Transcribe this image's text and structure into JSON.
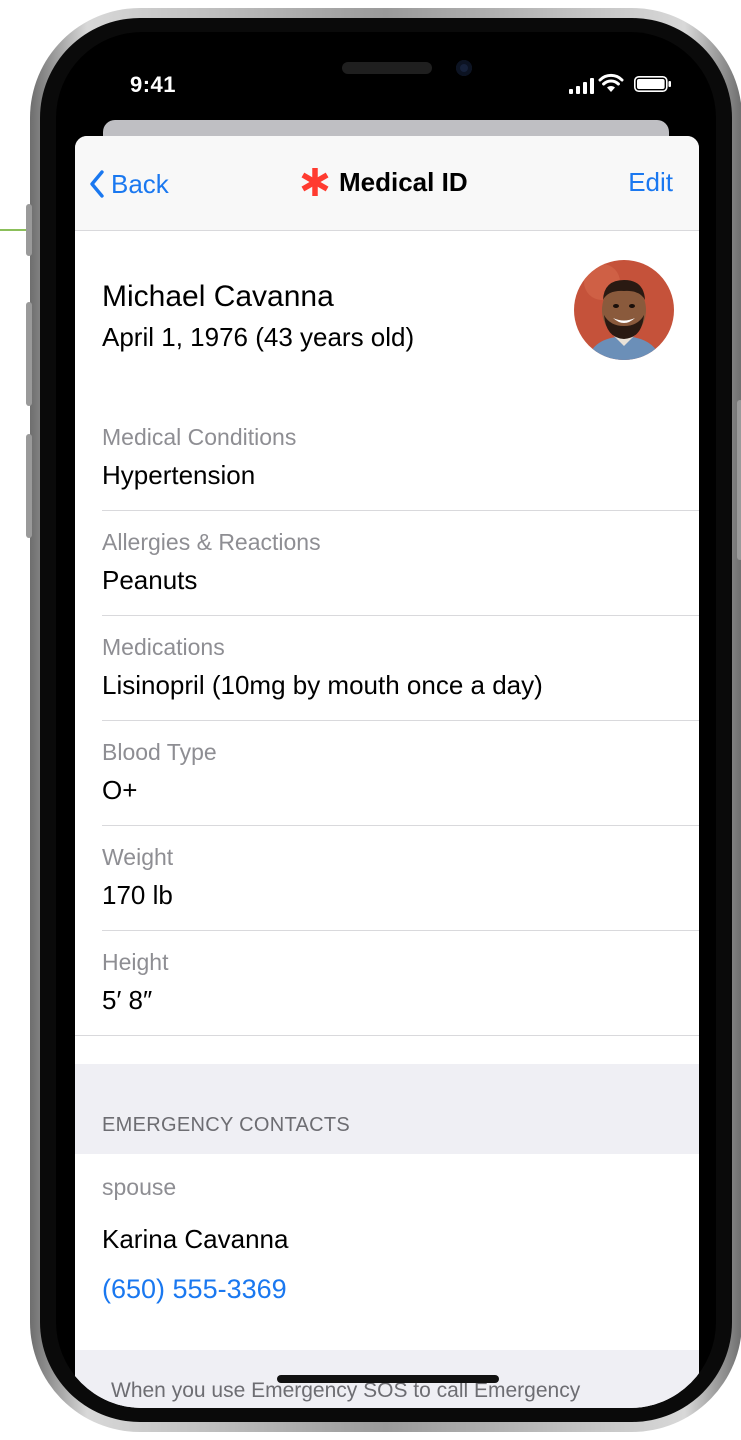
{
  "status_bar": {
    "time": "9:41"
  },
  "nav": {
    "back_label": "Back",
    "title": "Medical ID",
    "edit_label": "Edit",
    "accent_color": "#1a78f0",
    "asterisk_color": "#ff3b30"
  },
  "profile": {
    "name": "Michael Cavanna",
    "dob": "April 1, 1976 (43 years old)"
  },
  "fields": [
    {
      "label": "Medical Conditions",
      "value": "Hypertension"
    },
    {
      "label": "Allergies & Reactions",
      "value": "Peanuts"
    },
    {
      "label": "Medications",
      "value": "Lisinopril (10mg by mouth once a day)"
    },
    {
      "label": "Blood Type",
      "value": "O+"
    },
    {
      "label": "Weight",
      "value": "170 lb"
    },
    {
      "label": "Height",
      "value": "5′ 8″"
    }
  ],
  "emergency": {
    "header": "EMERGENCY CONTACTS",
    "contact": {
      "relation": "spouse",
      "name": "Karina Cavanna",
      "phone": "(650) 555-3369"
    }
  },
  "footer": {
    "text": "When you use Emergency SOS to call Emergency Services, your emergency contacts will be notified and"
  }
}
